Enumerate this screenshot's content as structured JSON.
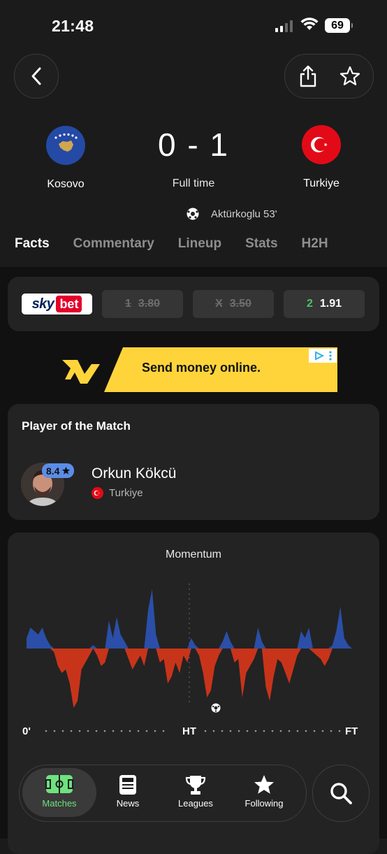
{
  "status_bar": {
    "time": "21:48",
    "battery": "69"
  },
  "header": {
    "back_icon": "chevron-left-icon",
    "share_icon": "share-icon",
    "favorite_icon": "star-outline-icon"
  },
  "match": {
    "home": {
      "name": "Kosovo"
    },
    "away": {
      "name": "Turkiye"
    },
    "score": "0 - 1",
    "status": "Full time",
    "scorer": "Aktürkoglu 53'"
  },
  "tabs": [
    "Facts",
    "Commentary",
    "Lineup",
    "Stats",
    "H2H"
  ],
  "odds": {
    "bookmaker": {
      "sky": "sky",
      "bet": "bet"
    },
    "options": [
      {
        "label": "1",
        "value": "3.80"
      },
      {
        "label": "X",
        "value": "3.50"
      },
      {
        "label": "2",
        "value": "1.91"
      }
    ]
  },
  "ad": {
    "text": "Send money online."
  },
  "potm": {
    "title": "Player of the Match",
    "rating": "8.4",
    "player_name": "Orkun Kökcü",
    "team": "Turkiye"
  },
  "momentum": {
    "title": "Momentum",
    "axis": {
      "start": "0'",
      "half": "HT",
      "end": "FT"
    },
    "colors": {
      "home": "#2b4fa8",
      "away": "#c8341a"
    },
    "values": [
      0.15,
      0.3,
      0.25,
      0.2,
      0.3,
      0.15,
      0.05,
      -0.05,
      -0.25,
      -0.35,
      -0.3,
      -0.5,
      -0.85,
      -0.75,
      -0.3,
      -0.2,
      -0.1,
      0.05,
      -0.1,
      -0.25,
      -0.2,
      0.4,
      0.15,
      0.45,
      0.2,
      0.1,
      -0.15,
      -0.3,
      -0.2,
      -0.1,
      -0.25,
      0.55,
      0.85,
      0.2,
      -0.2,
      -0.15,
      -0.5,
      -0.4,
      -0.2,
      -0.35,
      -0.1,
      -0.2,
      0.15,
      0.05,
      -0.1,
      -0.35,
      -0.7,
      -0.6,
      -0.25,
      -0.1,
      0.1,
      0.25,
      0.1,
      -0.2,
      -0.15,
      -0.7,
      -0.35,
      -0.25,
      -0.15,
      0.3,
      0.1,
      -0.55,
      -0.75,
      -0.4,
      -0.15,
      -0.2,
      -0.35,
      -0.5,
      -0.3,
      -0.1,
      0.25,
      0.15,
      0.3,
      -0.05,
      -0.1,
      -0.15,
      -0.25,
      -0.15,
      0.05,
      0.25,
      0.6,
      0.15,
      0.05,
      0.0
    ],
    "events_note": "goal-icon"
  },
  "nav": {
    "items": [
      {
        "label": "Matches",
        "icon": "pitch-icon"
      },
      {
        "label": "News",
        "icon": "newspaper-icon"
      },
      {
        "label": "Leagues",
        "icon": "trophy-icon"
      },
      {
        "label": "Following",
        "icon": "star-icon"
      }
    ],
    "search_icon": "search-icon"
  }
}
